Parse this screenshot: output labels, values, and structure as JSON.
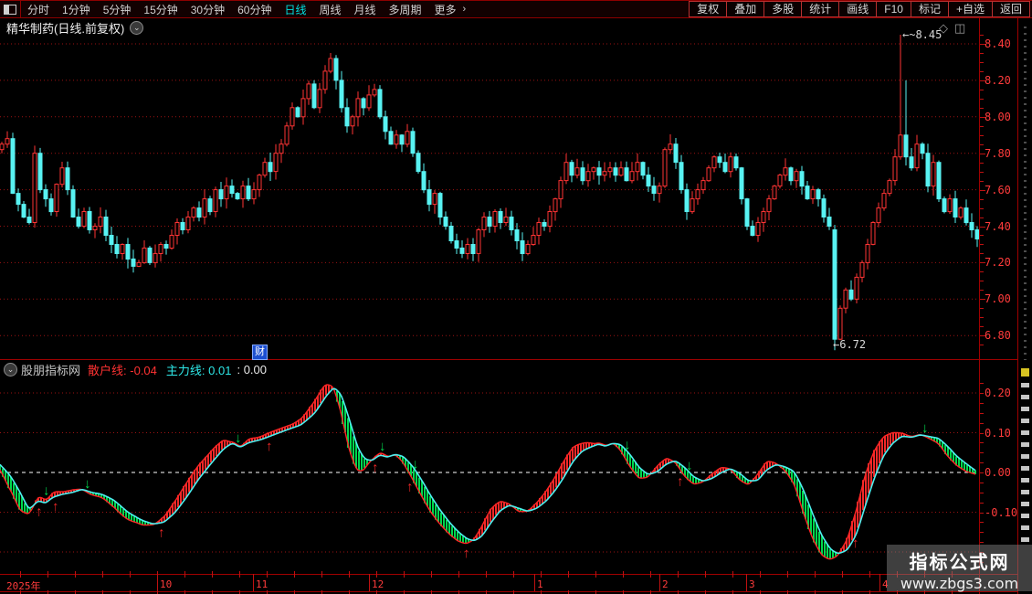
{
  "menubar": {
    "left_items": [
      {
        "label": "分时",
        "active": false
      },
      {
        "label": "1分钟",
        "active": false
      },
      {
        "label": "5分钟",
        "active": false
      },
      {
        "label": "15分钟",
        "active": false
      },
      {
        "label": "30分钟",
        "active": false
      },
      {
        "label": "60分钟",
        "active": false
      },
      {
        "label": "日线",
        "active": true
      },
      {
        "label": "周线",
        "active": false
      },
      {
        "label": "月线",
        "active": false
      },
      {
        "label": "多周期",
        "active": false
      },
      {
        "label": "更多",
        "active": false
      }
    ],
    "more_arrow": "›",
    "right_items": [
      "复权",
      "叠加",
      "多股",
      "统计",
      "画线",
      "F10",
      "标记",
      "+自选",
      "返回"
    ]
  },
  "titlebar": {
    "title": "精华制药(日线.前复权)",
    "chevron": "⌄"
  },
  "corner_icons": {
    "diamond": "◇",
    "panel": "◫"
  },
  "annotations": {
    "arrow": "←",
    "high": "~8.45",
    "low": "6.72",
    "fin_marker": "财"
  },
  "indicator_header": {
    "chevron": "⌄",
    "source": "股朋指标网",
    "line1_label": "散户线:",
    "line1_value": "-0.04",
    "line2_label": "主力线:",
    "line2_value": "0.01",
    "extra": ": 0.00"
  },
  "watermark": {
    "line1": "指标公式网",
    "line2": "www.zbgs3.com"
  },
  "colors": {
    "up": "#ff3434",
    "down": "#58f2f2",
    "grid": "#9c1212",
    "frame": "#a00000",
    "axis_text": "#ff3b3b",
    "band_red": "#f22828",
    "band_green": "#00d84e",
    "line_retail": "#ff2626",
    "line_main": "#4df0f0",
    "zero_line": "#ffffff",
    "active_tab": "#00e0e0",
    "fin_box": "#1d4fd0"
  },
  "chart_data": [
    {
      "type": "candlestick",
      "title": "精华制药 日线 前复权",
      "y_axis_labels": [
        "8.40",
        "8.20",
        "8.00",
        "7.80",
        "7.60",
        "7.40",
        "7.20",
        "7.00",
        "6.80"
      ],
      "x_axis_labels": [
        {
          "label": "2025年",
          "x": 4
        },
        {
          "label": "10",
          "x": 172
        },
        {
          "label": "11",
          "x": 277
        },
        {
          "label": "12",
          "x": 404
        },
        {
          "label": "1",
          "x": 585
        },
        {
          "label": "2",
          "x": 722
        },
        {
          "label": "3",
          "x": 817
        },
        {
          "label": "4",
          "x": 963
        }
      ],
      "annotated_high": 8.45,
      "annotated_low": 6.72,
      "first_open": 7.82,
      "closes": [
        7.85,
        7.88,
        7.58,
        7.52,
        7.45,
        7.42,
        7.8,
        7.6,
        7.55,
        7.48,
        7.63,
        7.72,
        7.6,
        7.45,
        7.4,
        7.48,
        7.38,
        7.4,
        7.45,
        7.35,
        7.3,
        7.25,
        7.3,
        7.22,
        7.18,
        7.2,
        7.28,
        7.2,
        7.25,
        7.3,
        7.28,
        7.35,
        7.42,
        7.38,
        7.45,
        7.5,
        7.45,
        7.55,
        7.48,
        7.6,
        7.55,
        7.62,
        7.58,
        7.55,
        7.62,
        7.55,
        7.6,
        7.68,
        7.75,
        7.7,
        7.8,
        7.85,
        7.95,
        8.05,
        8.0,
        8.1,
        8.18,
        8.05,
        8.15,
        8.25,
        8.32,
        8.2,
        8.05,
        7.95,
        8.0,
        8.1,
        8.05,
        8.12,
        8.15,
        8.0,
        7.92,
        7.85,
        7.9,
        7.85,
        7.92,
        7.8,
        7.7,
        7.6,
        7.52,
        7.58,
        7.45,
        7.4,
        7.32,
        7.28,
        7.25,
        7.3,
        7.25,
        7.38,
        7.45,
        7.4,
        7.48,
        7.42,
        7.45,
        7.38,
        7.32,
        7.25,
        7.3,
        7.35,
        7.42,
        7.4,
        7.48,
        7.55,
        7.65,
        7.75,
        7.68,
        7.72,
        7.65,
        7.7,
        7.72,
        7.68,
        7.7,
        7.72,
        7.68,
        7.72,
        7.65,
        7.7,
        7.75,
        7.68,
        7.62,
        7.58,
        7.62,
        7.82,
        7.85,
        7.75,
        7.6,
        7.48,
        7.55,
        7.6,
        7.65,
        7.72,
        7.78,
        7.75,
        7.7,
        7.78,
        7.72,
        7.55,
        7.4,
        7.35,
        7.42,
        7.48,
        7.55,
        7.62,
        7.68,
        7.72,
        7.65,
        7.7,
        7.62,
        7.55,
        7.6,
        7.55,
        7.45,
        7.4,
        6.78,
        6.95,
        7.05,
        7.0,
        7.12,
        7.2,
        7.3,
        7.42,
        7.5,
        7.58,
        7.65,
        7.78,
        7.9,
        7.78,
        7.72,
        7.85,
        7.8,
        7.62,
        7.75,
        7.55,
        7.48,
        7.55,
        7.45,
        7.5,
        7.42,
        7.38,
        7.33
      ],
      "overrides": {
        "152": {
          "open": 7.38,
          "low": 6.72
        },
        "164": {
          "high": 8.45
        },
        "165": {
          "high": 8.2
        }
      }
    },
    {
      "type": "line-band",
      "panel_title": "股朋指标网",
      "series": [
        {
          "name": "散户线",
          "color": "#ff3232",
          "last": -0.04
        },
        {
          "name": "主力线",
          "color": "#2ee8e8",
          "last": 0.01
        }
      ],
      "extra_value": 0.0,
      "y_axis_labels": [
        "0.20",
        "0.10",
        "0.00",
        "-0.10"
      ],
      "ylim": [
        -0.25,
        0.27
      ],
      "zero_line": 0,
      "keyframes": [
        [
          0,
          0.02
        ],
        [
          12,
          -0.01
        ],
        [
          22,
          -0.05
        ],
        [
          32,
          -0.095
        ],
        [
          42,
          -0.07
        ],
        [
          50,
          -0.078
        ],
        [
          58,
          -0.062
        ],
        [
          68,
          -0.055
        ],
        [
          80,
          -0.05
        ],
        [
          90,
          -0.042
        ],
        [
          100,
          -0.05
        ],
        [
          112,
          -0.055
        ],
        [
          125,
          -0.07
        ],
        [
          140,
          -0.1
        ],
        [
          155,
          -0.12
        ],
        [
          168,
          -0.13
        ],
        [
          180,
          -0.125
        ],
        [
          192,
          -0.1
        ],
        [
          205,
          -0.06
        ],
        [
          218,
          -0.015
        ],
        [
          232,
          0.025
        ],
        [
          245,
          0.06
        ],
        [
          255,
          0.075
        ],
        [
          263,
          0.062
        ],
        [
          272,
          0.075
        ],
        [
          285,
          0.082
        ],
        [
          300,
          0.095
        ],
        [
          315,
          0.108
        ],
        [
          330,
          0.12
        ],
        [
          345,
          0.15
        ],
        [
          358,
          0.195
        ],
        [
          366,
          0.215
        ],
        [
          374,
          0.195
        ],
        [
          383,
          0.13
        ],
        [
          392,
          0.06
        ],
        [
          400,
          0.032
        ],
        [
          408,
          0.03
        ],
        [
          416,
          0.045
        ],
        [
          424,
          0.038
        ],
        [
          433,
          0.046
        ],
        [
          442,
          0.04
        ],
        [
          452,
          0.015
        ],
        [
          462,
          -0.02
        ],
        [
          472,
          -0.06
        ],
        [
          482,
          -0.095
        ],
        [
          492,
          -0.125
        ],
        [
          502,
          -0.15
        ],
        [
          512,
          -0.168
        ],
        [
          520,
          -0.172
        ],
        [
          528,
          -0.16
        ],
        [
          538,
          -0.125
        ],
        [
          548,
          -0.095
        ],
        [
          558,
          -0.082
        ],
        [
          568,
          -0.09
        ],
        [
          578,
          -0.098
        ],
        [
          588,
          -0.09
        ],
        [
          598,
          -0.072
        ],
        [
          608,
          -0.045
        ],
        [
          618,
          -0.01
        ],
        [
          628,
          0.03
        ],
        [
          638,
          0.055
        ],
        [
          648,
          0.065
        ],
        [
          656,
          0.072
        ],
        [
          663,
          0.065
        ],
        [
          671,
          0.074
        ],
        [
          680,
          0.07
        ],
        [
          690,
          0.045
        ],
        [
          700,
          0.012
        ],
        [
          710,
          -0.006
        ],
        [
          720,
          0.002
        ],
        [
          730,
          0.022
        ],
        [
          740,
          0.03
        ],
        [
          750,
          0.012
        ],
        [
          760,
          -0.012
        ],
        [
          770,
          -0.022
        ],
        [
          780,
          -0.015
        ],
        [
          790,
          0.0
        ],
        [
          800,
          0.01
        ],
        [
          810,
          -0.002
        ],
        [
          820,
          -0.022
        ],
        [
          830,
          -0.02
        ],
        [
          840,
          0.008
        ],
        [
          850,
          0.02
        ],
        [
          860,
          0.014
        ],
        [
          870,
          0.002
        ],
        [
          880,
          -0.045
        ],
        [
          890,
          -0.105
        ],
        [
          900,
          -0.16
        ],
        [
          910,
          -0.195
        ],
        [
          918,
          -0.205
        ],
        [
          928,
          -0.195
        ],
        [
          938,
          -0.155
        ],
        [
          948,
          -0.08
        ],
        [
          958,
          -0.01
        ],
        [
          968,
          0.045
        ],
        [
          978,
          0.075
        ],
        [
          988,
          0.092
        ],
        [
          998,
          0.088
        ],
        [
          1008,
          0.095
        ],
        [
          1018,
          0.09
        ],
        [
          1028,
          0.086
        ],
        [
          1038,
          0.065
        ],
        [
          1048,
          0.04
        ],
        [
          1058,
          0.022
        ],
        [
          1068,
          0.005
        ]
      ],
      "buy_arrows_x": [
        44,
        62,
        178,
        296,
        412,
        450,
        512,
        746,
        938
      ],
      "sell_arrows_x": [
        52,
        97,
        262,
        420,
        456,
        688,
        756,
        1014
      ]
    }
  ]
}
